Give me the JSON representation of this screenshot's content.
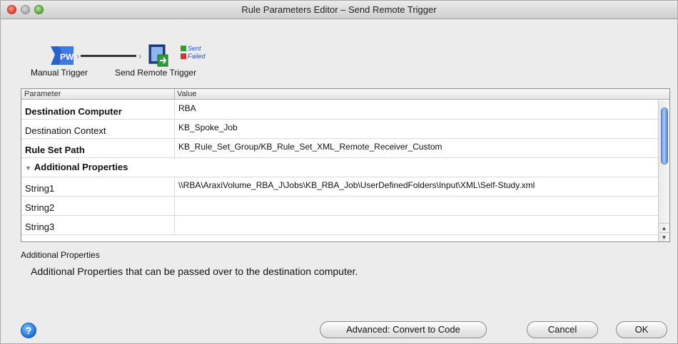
{
  "window": {
    "title": "Rule Parameters Editor – Send Remote Trigger"
  },
  "flow": {
    "manual_label": "Manual Trigger",
    "remote_label": "Send Remote Trigger",
    "pw_text": "PW",
    "sent_label": "Sent",
    "failed_label": "Failed"
  },
  "table": {
    "columns": [
      "Parameter",
      "Value"
    ],
    "rows": [
      {
        "param": "Destination Computer",
        "value": "RBA",
        "bold": true
      },
      {
        "param": "Destination Context",
        "value": "KB_Spoke_Job",
        "bold": false
      },
      {
        "param": "Rule Set Path",
        "value": "KB_Rule_Set_Group/KB_Rule_Set_XML_Remote_Receiver_Custom",
        "bold": true
      },
      {
        "param": "Additional Properties",
        "value": "",
        "section": true
      },
      {
        "param": "String1",
        "value": "\\\\RBA\\AraxiVolume_RBA_J\\Jobs\\KB_RBA_Job\\UserDefinedFolders\\Input\\XML\\Self-Study.xml",
        "bold": false
      },
      {
        "param": "String2",
        "value": "",
        "bold": false
      },
      {
        "param": "String3",
        "value": "",
        "bold": false
      }
    ]
  },
  "description": {
    "title": "Additional Properties",
    "body": "Additional Properties that can be passed over to the destination computer."
  },
  "footer": {
    "help_label": "?",
    "advanced_label": "Advanced: Convert to Code",
    "cancel_label": "Cancel",
    "ok_label": "OK"
  },
  "colors": {
    "accent": "#2455c8",
    "sent": "#2f9b3d",
    "failed": "#d5332b"
  }
}
